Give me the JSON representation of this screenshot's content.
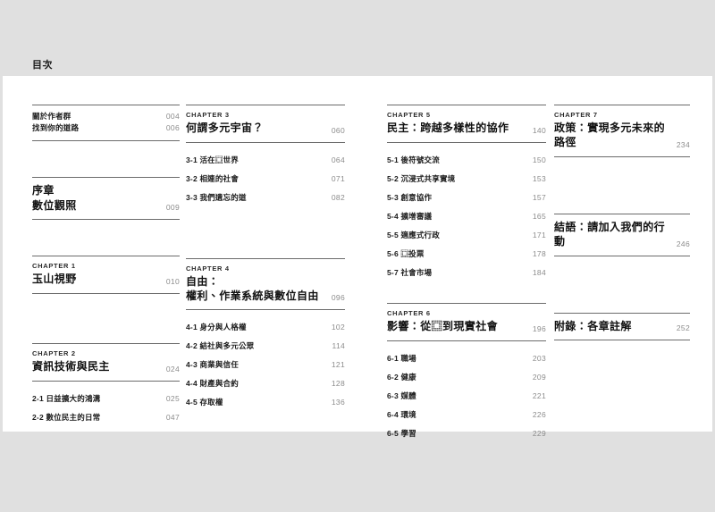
{
  "page": {
    "running_head": "目次",
    "background_color": "#e0e0e0",
    "sheet_color": "#ffffff",
    "rule_color": "#6b6b6b",
    "page_number_color": "#8c8c8c"
  },
  "columns": [
    {
      "id": "column-1",
      "blocks": [
        {
          "kind": "entry-list",
          "entries": [
            {
              "label": "關於作者群",
              "page": "004"
            },
            {
              "label": "找到你的道路",
              "page": "006"
            }
          ]
        },
        {
          "kind": "big-heading",
          "title_line_1": "序章",
          "title_line_2": "數位觀照",
          "page": "009"
        },
        {
          "kind": "chapter",
          "eyebrow": "CHAPTER 1",
          "title": "玉山視野",
          "page": "010",
          "sections": []
        },
        {
          "kind": "chapter",
          "eyebrow": "CHAPTER 2",
          "title": "資訊技術與民主",
          "page": "024",
          "sections": [
            {
              "label": "2-1 日益擴大的鴻溝",
              "page": "025"
            },
            {
              "label": "2-2 數位民主的日常",
              "page": "047"
            }
          ]
        }
      ]
    },
    {
      "id": "column-2",
      "blocks": [
        {
          "kind": "chapter",
          "eyebrow": "CHAPTER 3",
          "title": "何謂多元宇宙？",
          "page": "060",
          "sections": [
            {
              "label": "3-1 活在⿴世界",
              "page": "064"
            },
            {
              "label": "3-2 相連的社會",
              "page": "071"
            },
            {
              "label": "3-3 我們遺忘的道",
              "page": "082"
            }
          ]
        },
        {
          "kind": "chapter",
          "eyebrow": "CHAPTER 4",
          "title_line_1": "自由：",
          "title_line_2": "權利、作業系統與數位自由",
          "page": "096",
          "sections": [
            {
              "label": "4-1 身分與人格權",
              "page": "102"
            },
            {
              "label": "4-2 結社與多元公眾",
              "page": "114"
            },
            {
              "label": "4-3 商業與信任",
              "page": "121"
            },
            {
              "label": "4-4 財產與合約",
              "page": "128"
            },
            {
              "label": "4-5 存取權",
              "page": "136"
            }
          ]
        }
      ]
    },
    {
      "id": "column-3",
      "blocks": [
        {
          "kind": "chapter",
          "eyebrow": "CHAPTER 5",
          "title": "民主：跨越多樣性的協作",
          "page": "140",
          "sections": [
            {
              "label": "5-1 後符號交流",
              "page": "150"
            },
            {
              "label": "5-2 沉浸式共享實境",
              "page": "153"
            },
            {
              "label": "5-3 創意協作",
              "page": "157"
            },
            {
              "label": "5-4 擴增審議",
              "page": "165"
            },
            {
              "label": "5-5 適應式行政",
              "page": "171"
            },
            {
              "label": "5-6 ⿴投票",
              "page": "178"
            },
            {
              "label": "5-7 社會市場",
              "page": "184"
            }
          ]
        },
        {
          "kind": "chapter",
          "eyebrow": "CHAPTER 6",
          "title": "影響：從⿴到現實社會",
          "page": "196",
          "sections": [
            {
              "label": "6-1 職場",
              "page": "203"
            },
            {
              "label": "6-2 健康",
              "page": "209"
            },
            {
              "label": "6-3 媒體",
              "page": "221"
            },
            {
              "label": "6-4 環境",
              "page": "226"
            },
            {
              "label": "6-5 學習",
              "page": "229"
            }
          ]
        }
      ]
    },
    {
      "id": "column-4",
      "blocks": [
        {
          "kind": "chapter",
          "eyebrow": "CHAPTER 7",
          "title": "政策：實現多元未來的路徑",
          "page": "234",
          "sections": []
        },
        {
          "kind": "big-heading",
          "title_line_1": "結語：請加入我們的行動",
          "page": "246"
        },
        {
          "kind": "big-heading",
          "title_line_1": "附錄：各章註解",
          "page": "252"
        }
      ]
    }
  ]
}
